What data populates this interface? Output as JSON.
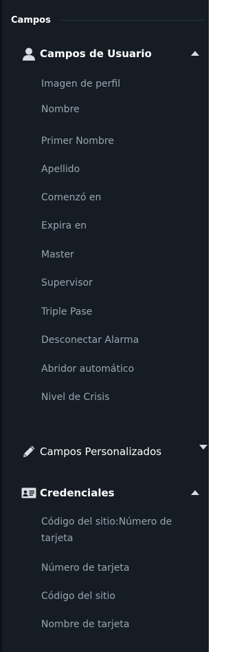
{
  "panel": {
    "title": "Campos"
  },
  "sections": [
    {
      "label": "Campos de Usuario",
      "icon": "user-icon",
      "expanded": true,
      "items": [
        "Imagen de perfil",
        "Nombre",
        "Primer Nombre",
        "Apellido",
        "Comenzó en",
        "Expira en",
        "Master",
        "Supervisor",
        "Triple Pase",
        "Desconectar Alarma",
        "Abridor automático",
        "Nivel de Crisis"
      ]
    },
    {
      "label": "Campos Personalizados",
      "icon": "pencil-icon",
      "expanded": false,
      "items": []
    },
    {
      "label": "Credenciales",
      "icon": "id-card-icon",
      "expanded": true,
      "items": [
        "Código del sitio:Número de tarjeta",
        "Número de tarjeta",
        "Código del sitio",
        "Nombre de tarjeta"
      ]
    }
  ],
  "colors": {
    "panel_background": "#161c24",
    "heading_text": "#ffffff",
    "item_text": "#9aa4b0",
    "caret": "#d9dde2"
  }
}
